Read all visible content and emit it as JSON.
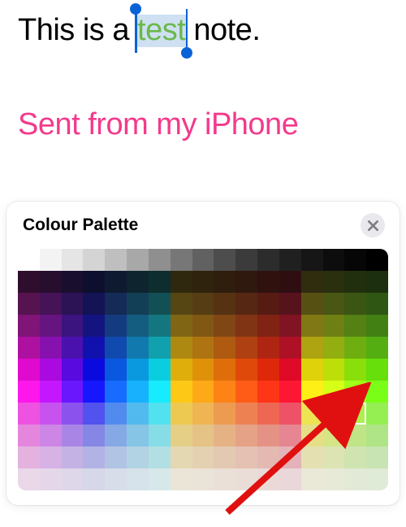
{
  "note": {
    "prefix": "This is a ",
    "selected": "test",
    "suffix": " note.",
    "signature": "Sent from my iPhone"
  },
  "panel": {
    "title": "Colour Palette"
  },
  "palette": {
    "cols": 17,
    "rows": 11,
    "selected": {
      "row": 7,
      "col": 15
    },
    "top_row": [
      "#ffffff",
      "#f3f3f3",
      "#e5e5e5",
      "#d4d4d4",
      "#bfbfbf",
      "#a8a8a8",
      "#8f8f8f",
      "#777777",
      "#616161",
      "#4d4d4d",
      "#3b3b3b",
      "#2c2c2c",
      "#202020",
      "#161616",
      "#0d0d0d",
      "#060606",
      "#000000"
    ],
    "base_hues": [
      300,
      280,
      260,
      240,
      220,
      200,
      180,
      40,
      30,
      20,
      10,
      0,
      350,
      60,
      75,
      90,
      95
    ],
    "hue_adjust": [
      0,
      0,
      0,
      0,
      0,
      0,
      0,
      0,
      0,
      0,
      0,
      0,
      0,
      0,
      0,
      0,
      0
    ]
  }
}
